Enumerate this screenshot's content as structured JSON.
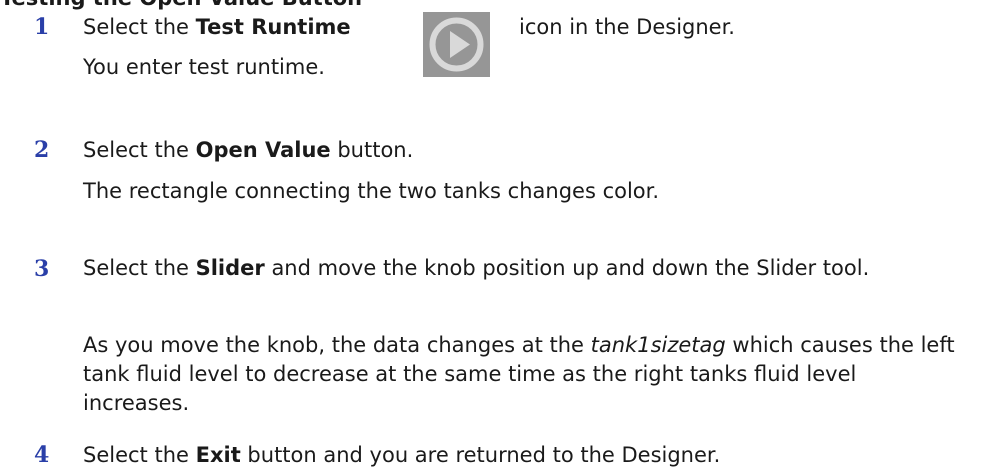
{
  "heading": "Testing the Open Value Button",
  "steps": [
    {
      "num": "1",
      "pre": "Select the ",
      "bold": "Test Runtime",
      "post": " icon in the Designer.",
      "result": "You enter test runtime."
    },
    {
      "num": "2",
      "pre": "Select the ",
      "bold": "Open Value",
      "post": " button.",
      "result": "The rectangle connecting the two tanks changes color."
    },
    {
      "num": "3",
      "pre": "Select the ",
      "bold": "Slider",
      "post": " and move the knob position up and down the Slider tool.",
      "result_pre": "As you move the knob, the data changes at the ",
      "result_italic": "tank1sizetag",
      "result_post": " which causes the left tank fluid level to decrease at the same time as the right tanks fluid level increases."
    },
    {
      "num": "4",
      "pre": "Select the ",
      "bold": "Exit",
      "post": " button and you are returned to the Designer."
    }
  ],
  "icon": {
    "name": "play-icon",
    "bg": "#969696",
    "ring": "#d9d9d9"
  },
  "colors": {
    "step_number": "#2a3fa8",
    "text": "#1a1a1a"
  }
}
